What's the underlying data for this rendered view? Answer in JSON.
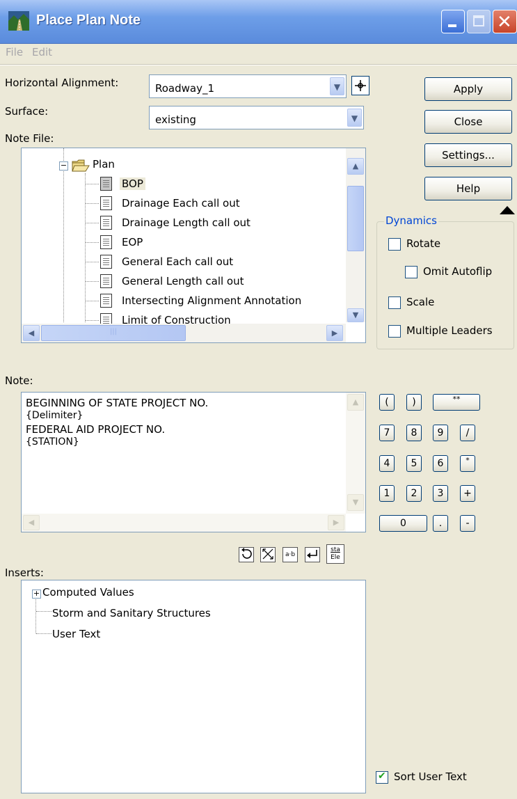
{
  "window": {
    "title": "Place Plan Note"
  },
  "menu": {
    "file": "File",
    "edit": "Edit"
  },
  "form": {
    "horizontal_alignment_label": "Horizontal Alignment:",
    "horizontal_alignment_value": "Roadway_1",
    "surface_label": "Surface:",
    "surface_value": "existing",
    "note_file_label": "Note File:",
    "note_label": "Note:",
    "inserts_label": "Inserts:"
  },
  "buttons": {
    "apply": "Apply",
    "close": "Close",
    "settings": "Settings...",
    "help": "Help"
  },
  "note_tree": {
    "folder": "Plan",
    "items": [
      "BOP",
      "Drainage Each call out",
      "Drainage Length call out",
      "EOP",
      "General Each call out",
      "General Length call out",
      "Intersecting Alignment Annotation",
      "Limit of Construction"
    ],
    "selected": "BOP"
  },
  "dynamics": {
    "title": "Dynamics",
    "rotate": {
      "label": "Rotate",
      "checked": false
    },
    "omit_autoflip": {
      "label": "Omit Autoflip",
      "checked": false
    },
    "scale": {
      "label": "Scale",
      "checked": false
    },
    "multiple_leaders": {
      "label": "Multiple Leaders",
      "checked": false
    }
  },
  "note_text": {
    "lines": [
      "BEGINNING OF STATE PROJECT NO.",
      "{Delimiter}",
      "FEDERAL AID PROJECT NO.",
      "{STATION}"
    ]
  },
  "keypad": {
    "row1": [
      "(",
      ")",
      "**"
    ],
    "row2": [
      "7",
      "8",
      "9",
      "/"
    ],
    "row3": [
      "4",
      "5",
      "6",
      "*"
    ],
    "row4": [
      "1",
      "2",
      "3",
      "+"
    ],
    "row5": [
      "0",
      ".",
      "-"
    ]
  },
  "note_tools": {
    "tool5_top": "sta",
    "tool5_bottom": "Ele",
    "tool3": "a·b"
  },
  "inserts_tree": {
    "items": [
      "Computed Values",
      "Storm and Sanitary Structures",
      "User Text"
    ]
  },
  "sort_user_text": {
    "label": "Sort User Text",
    "checked": true
  },
  "icons": {
    "app": "road-app-icon",
    "minimize": "minimize-icon",
    "maximize": "maximize-icon",
    "close": "close-icon",
    "dropdown": "chevron-down-icon",
    "pick": "crosshair-icon",
    "folder": "open-folder-icon",
    "document": "document-icon",
    "undo": "undo-icon",
    "wrap": "text-wrap-icon",
    "space": "space-icon",
    "enter": "enter-icon",
    "collapse": "collapse-triangle-icon"
  }
}
